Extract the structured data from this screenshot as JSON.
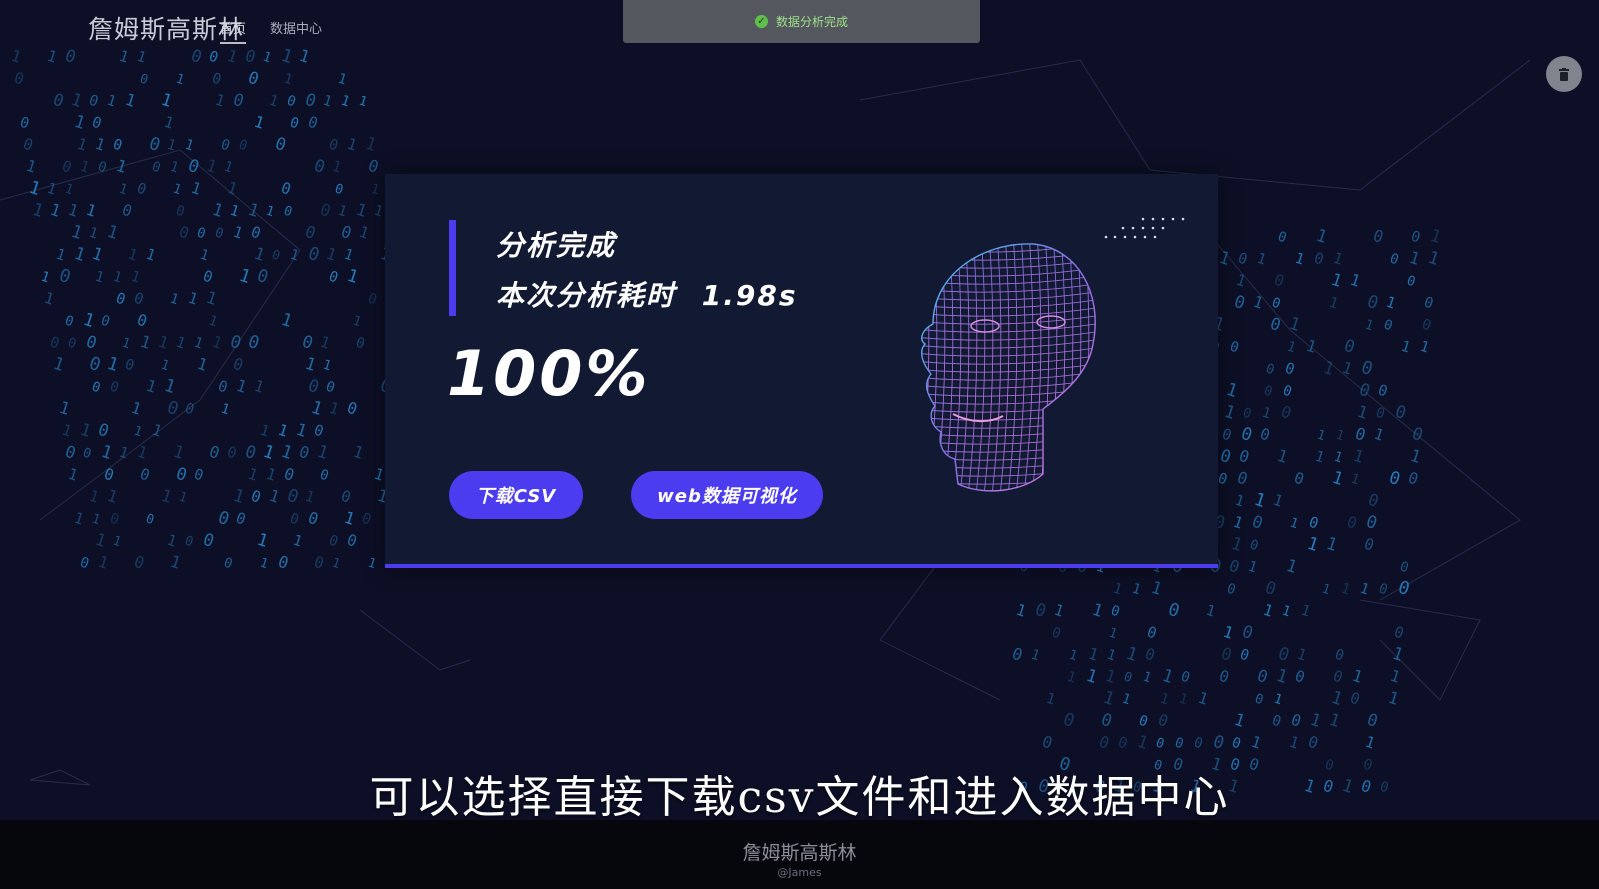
{
  "header": {
    "logo_text": "詹姆斯高斯林",
    "nav": [
      {
        "label": "首页",
        "active": true
      },
      {
        "label": "数据中心",
        "active": false
      }
    ]
  },
  "toast": {
    "icon": "check-circle-icon",
    "message": "数据分析完成"
  },
  "trash_button": {
    "icon": "trash-icon"
  },
  "result_card": {
    "title": "分析完成",
    "timeline_label": "本次分析耗时",
    "timeline_value": "1.98s",
    "progress_text": "100%",
    "progress_value": 1.0,
    "buttons": {
      "download": "下载CSV",
      "visualize": "web数据可视化"
    },
    "illustration": "wireframe-face-icon"
  },
  "subtitle": "可以选择直接下载csv文件和进入数据中心",
  "watermark": {
    "logo": "詹姆斯高斯林",
    "user": "@James"
  },
  "colors": {
    "background": "#0d0f26",
    "accent": "#4b3cf0",
    "card": "#121932",
    "digit_rain": "#2a8fd6"
  }
}
